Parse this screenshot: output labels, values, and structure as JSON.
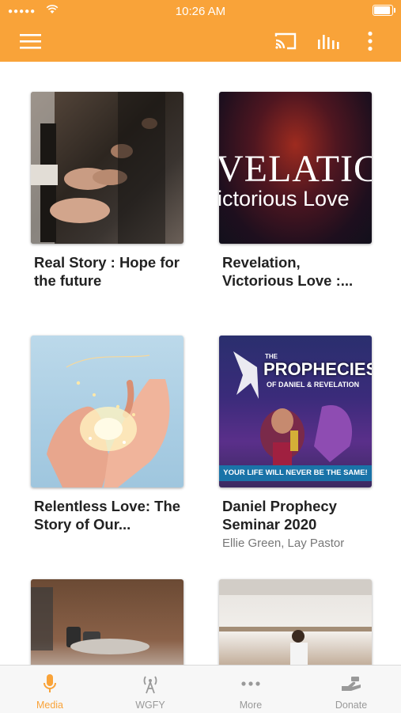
{
  "status_bar": {
    "signal": "●●●●●",
    "time": "10:26 AM"
  },
  "toolbar": {
    "menu_icon": "hamburger-menu-icon",
    "cast_icon": "cast-icon",
    "audio_icon": "audio-bars-icon",
    "more_icon": "vertical-dots-icon"
  },
  "cards": [
    {
      "title": "Real Story : Hope for the future",
      "subtitle": ""
    },
    {
      "title": "Revelation, Victorious Love :...",
      "subtitle": "",
      "art_line1": "VELATIC",
      "art_line2": "ictorious Love"
    },
    {
      "title": "Relentless Love: The Story of Our...",
      "subtitle": ""
    },
    {
      "title": "Daniel Prophecy Seminar 2020",
      "subtitle": "Ellie Green, Lay Pastor",
      "art_title": "PROPHECIES",
      "art_prefix": "THE",
      "art_sub": "OF DANIEL & REVELATION",
      "art_banner": "YOUR LIFE WILL NEVER BE THE SAME!"
    },
    {
      "title": "",
      "subtitle": ""
    },
    {
      "title": "",
      "subtitle": ""
    }
  ],
  "tabs": [
    {
      "label": "Media",
      "icon": "microphone-icon",
      "active": true
    },
    {
      "label": "WGFY",
      "icon": "radio-antenna-icon",
      "active": false
    },
    {
      "label": "More",
      "icon": "more-dots-icon",
      "active": false
    },
    {
      "label": "Donate",
      "icon": "donate-hand-icon",
      "active": false
    }
  ],
  "colors": {
    "accent": "#f9a339",
    "tab_inactive": "#999999"
  }
}
